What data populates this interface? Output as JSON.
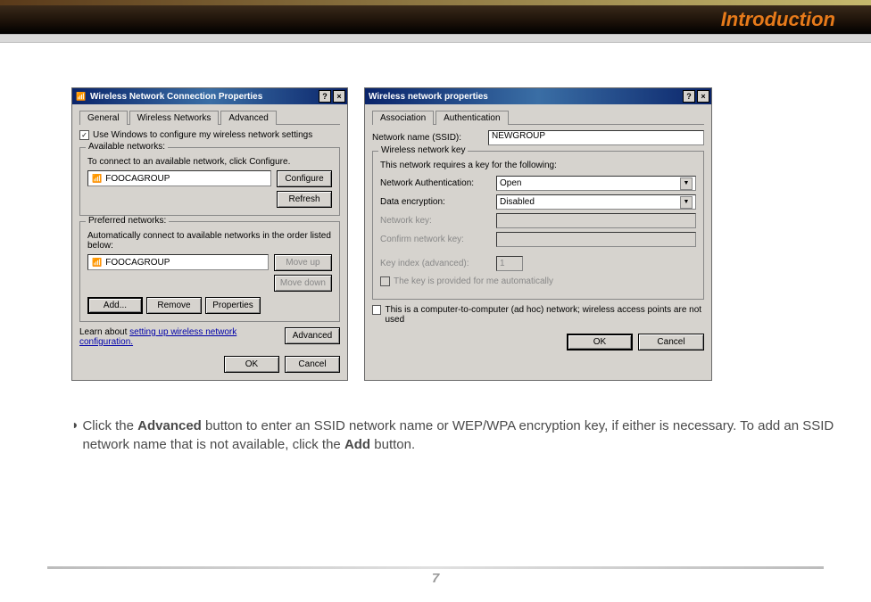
{
  "header": {
    "title": "Introduction"
  },
  "dialog1": {
    "title": "Wireless Network Connection Properties",
    "tabs": [
      "General",
      "Wireless Networks",
      "Advanced"
    ],
    "active_tab": 1,
    "use_windows_checkbox": "Use Windows to configure my wireless network settings",
    "use_windows_checked": true,
    "available": {
      "legend": "Available networks:",
      "hint": "To connect to an available network, click Configure.",
      "item": "FOOCAGROUP",
      "configure_btn": "Configure",
      "refresh_btn": "Refresh"
    },
    "preferred": {
      "legend": "Preferred networks:",
      "hint": "Automatically connect to available networks in the order listed below:",
      "item": "FOOCAGROUP",
      "move_up_btn": "Move up",
      "move_down_btn": "Move down",
      "add_btn": "Add...",
      "remove_btn": "Remove",
      "properties_btn": "Properties"
    },
    "learn_text": "Learn about",
    "learn_link": "setting up wireless network configuration.",
    "advanced_btn": "Advanced",
    "ok_btn": "OK",
    "cancel_btn": "Cancel"
  },
  "dialog2": {
    "title": "Wireless network properties",
    "tabs": [
      "Association",
      "Authentication"
    ],
    "active_tab": 0,
    "ssid_label": "Network name (SSID):",
    "ssid_value": "NEWGROUP",
    "key_group_legend": "Wireless network key",
    "key_hint": "This network requires a key for the following:",
    "auth_label": "Network Authentication:",
    "auth_value": "Open",
    "enc_label": "Data encryption:",
    "enc_value": "Disabled",
    "net_key_label": "Network key:",
    "confirm_key_label": "Confirm network key:",
    "key_index_label": "Key index (advanced):",
    "key_index_value": "1",
    "auto_key_label": "The key is provided for me automatically",
    "adhoc_label": "This is a computer-to-computer (ad hoc) network; wireless access points are not used",
    "ok_btn": "OK",
    "cancel_btn": "Cancel"
  },
  "instruction": {
    "bullet": "◗",
    "pre1": "Click the ",
    "bold1": "Advanced",
    "mid1": " button to enter an SSID network name or WEP/WPA encryption key, if either is necessary.  To add an SSID network name that is not available, click the ",
    "bold2": "Add",
    "post2": " button."
  },
  "footer": {
    "page": "7"
  }
}
